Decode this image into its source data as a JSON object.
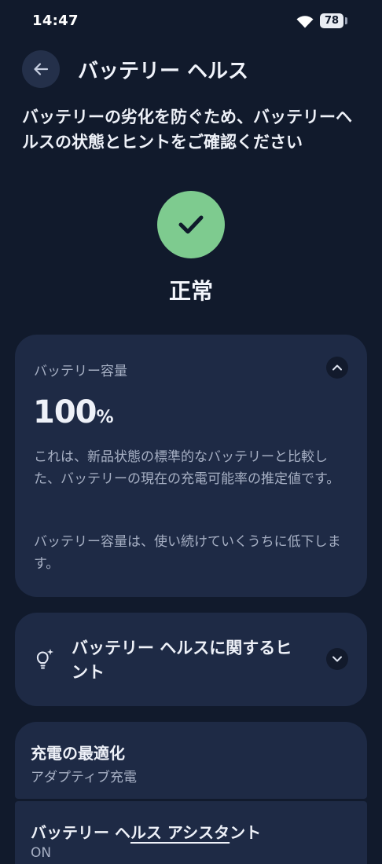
{
  "status_bar": {
    "time": "14:47",
    "battery_level": "78"
  },
  "header": {
    "title": "バッテリー ヘルス"
  },
  "intro": "バッテリーの劣化を防ぐため、バッテリーヘルスの状態とヒントをご確認ください",
  "health_status": {
    "label": "正常",
    "color": "#7ecb8f"
  },
  "capacity_card": {
    "label": "バッテリー容量",
    "value": "100",
    "unit": "%",
    "description1": "これは、新品状態の標準的なバッテリーと比較した、バッテリーの現在の充電可能率の推定値です。",
    "description2": "バッテリー容量は、使い続けていくうちに低下します。"
  },
  "tips_card": {
    "label": "バッテリー ヘルスに関するヒント"
  },
  "settings": [
    {
      "title": "充電の最適化",
      "subtitle": "アダプティブ充電"
    },
    {
      "title_prefix": "バッテリー ヘ",
      "title_underlined": "ルス アシスタ",
      "title_suffix": "ント",
      "subtitle": "ON"
    }
  ]
}
